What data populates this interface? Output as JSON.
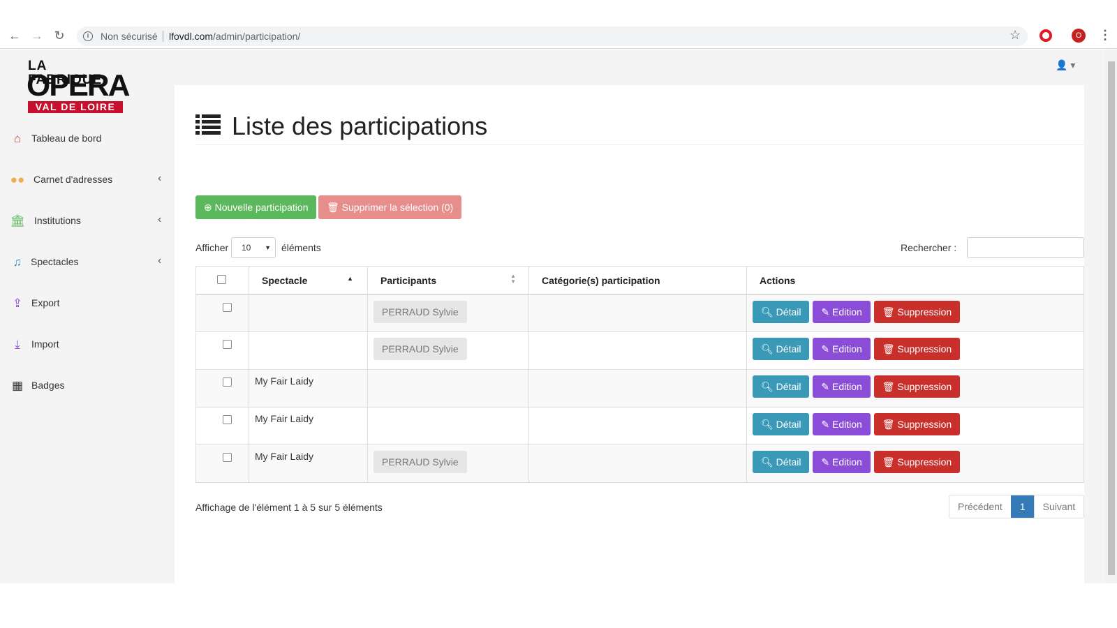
{
  "browser": {
    "security_label": "Non sécurisé",
    "url_domain": "lfovdl.com",
    "url_path": "/admin/participation/",
    "avatar_letter": "O"
  },
  "logo": {
    "line1": "LA FABRIQUE",
    "line2": "OPERA",
    "line3": "VAL DE LOIRE"
  },
  "sidebar": {
    "items": [
      {
        "label": "Tableau de bord",
        "icon": "home-icon",
        "color": "#c9302c"
      },
      {
        "label": "Carnet d'adresses",
        "icon": "users-icon",
        "color": "#f0ad4e"
      },
      {
        "label": "Institutions",
        "icon": "institution-icon",
        "color": "#5cb85c"
      },
      {
        "label": "Spectacles",
        "icon": "music-icon",
        "color": "#3b99b8"
      },
      {
        "label": "Export",
        "icon": "upload-icon",
        "color": "#8b4dd8"
      },
      {
        "label": "Import",
        "icon": "download-icon",
        "color": "#8b4dd8"
      },
      {
        "label": "Badges",
        "icon": "th-large-icon",
        "color": "#333333"
      }
    ]
  },
  "page": {
    "title": "Liste des participations",
    "new_button": "Nouvelle participation",
    "delete_selection_button": "Supprimer la sélection (0)",
    "length_prefix": "Afficher",
    "length_value": "10",
    "length_suffix": "éléments",
    "search_label": "Rechercher :",
    "search_value": ""
  },
  "table": {
    "columns": [
      "Spectacle",
      "Participants",
      "Catégorie(s) participation",
      "Actions"
    ],
    "rows": [
      {
        "spectacle": "",
        "participant": "PERRAUD Sylvie",
        "categories": ""
      },
      {
        "spectacle": "",
        "participant": "PERRAUD Sylvie",
        "categories": ""
      },
      {
        "spectacle": "My Fair Laidy",
        "participant": "",
        "categories": ""
      },
      {
        "spectacle": "My Fair Laidy",
        "participant": "",
        "categories": ""
      },
      {
        "spectacle": "My Fair Laidy",
        "participant": "PERRAUD Sylvie",
        "categories": ""
      }
    ],
    "actions": {
      "detail": "Détail",
      "edit": "Edition",
      "delete": "Suppression"
    }
  },
  "footer": {
    "info": "Affichage de l'élément 1 à 5 sur 5 éléments",
    "previous": "Précédent",
    "current_page": "1",
    "next": "Suivant"
  },
  "colors": {
    "success": "#5cb85c",
    "danger": "#d9534f",
    "info": "#3b99b8",
    "edit": "#8b4dd8",
    "primary": "#337ab7"
  }
}
